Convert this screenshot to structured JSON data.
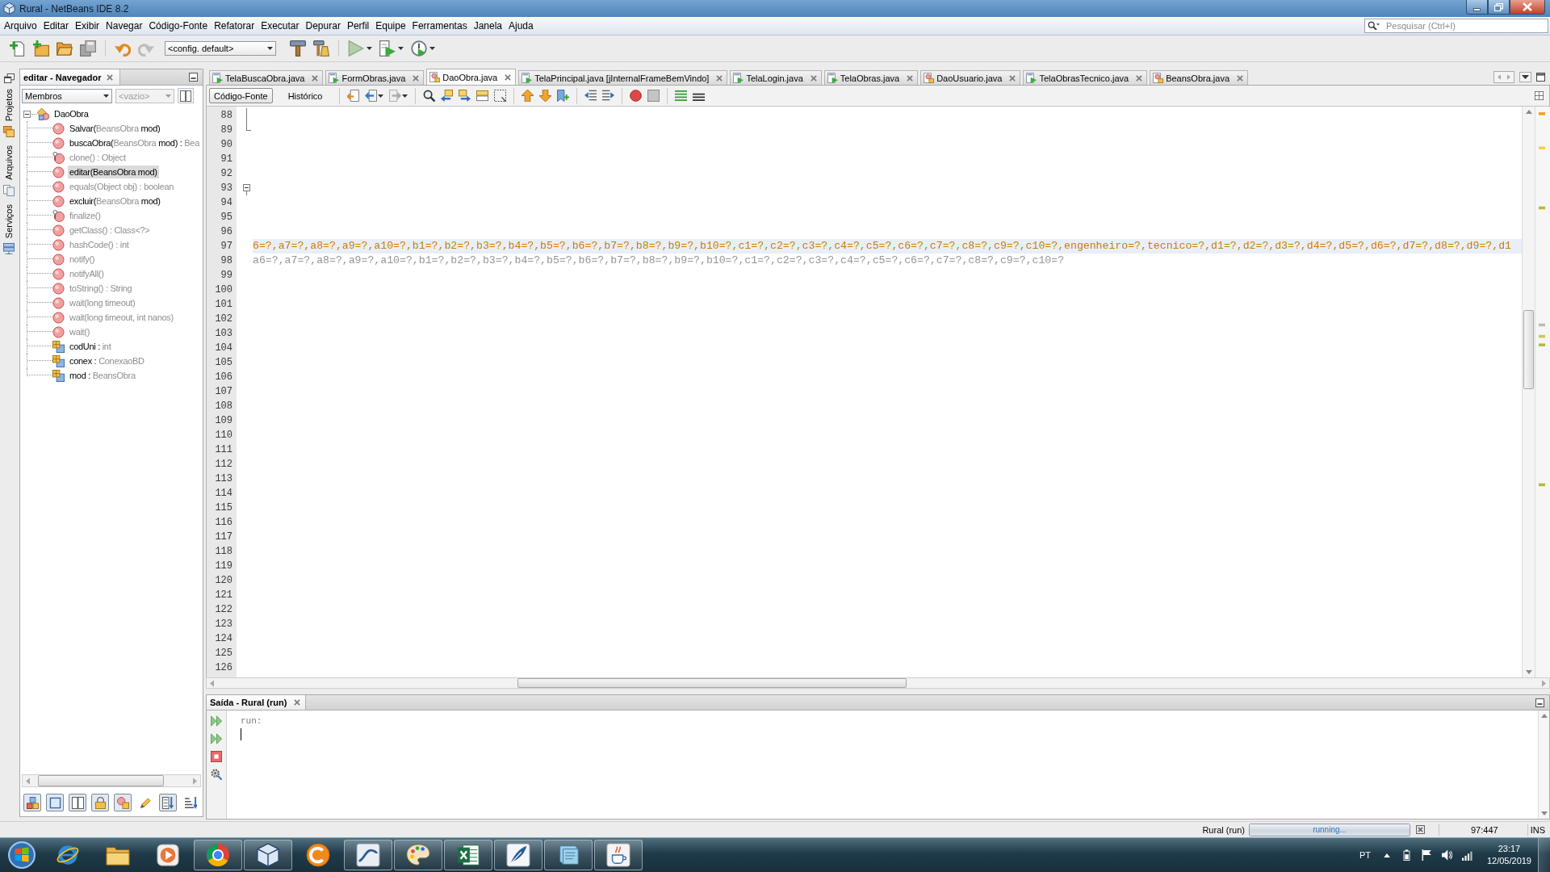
{
  "window": {
    "title": "Rural - NetBeans IDE 8.2"
  },
  "menu": [
    "Arquivo",
    "Editar",
    "Exibir",
    "Navegar",
    "Código-Fonte",
    "Refatorar",
    "Executar",
    "Depurar",
    "Perfil",
    "Equipe",
    "Ferramentas",
    "Janela",
    "Ajuda"
  ],
  "search": {
    "placeholder": "Pesquisar (Ctrl+I)"
  },
  "toolbar": {
    "config": "<config. default>"
  },
  "side_tabs": [
    "Projetos",
    "Arquivos",
    "Serviços"
  ],
  "navigator": {
    "title": "editar - Navegador",
    "filter": {
      "value": "Membros",
      "disabled": false
    },
    "scope": {
      "value": "<vazio>",
      "disabled": true
    },
    "tree": {
      "kind": "class",
      "label": "DaoObra",
      "expanded": true,
      "selected": false,
      "children": [
        {
          "kind": "method",
          "selected": false,
          "segments": [
            {
              "text": "Salvar(",
              "muted": false
            },
            {
              "text": "BeansObra",
              "muted": true
            },
            {
              "text": " mod)",
              "muted": false
            }
          ]
        },
        {
          "kind": "method",
          "selected": false,
          "segments": [
            {
              "text": "buscaObra(",
              "muted": false
            },
            {
              "text": "BeansObra",
              "muted": true
            },
            {
              "text": " mod) : ",
              "muted": false
            },
            {
              "text": "Bea",
              "muted": true
            }
          ]
        },
        {
          "kind": "protected_method",
          "selected": false,
          "segments": [
            {
              "text": "clone() : Object",
              "muted": true
            }
          ]
        },
        {
          "kind": "method",
          "selected": true,
          "segments": [
            {
              "text": "editar(BeansObra mod)",
              "muted": false
            }
          ]
        },
        {
          "kind": "method",
          "selected": false,
          "segments": [
            {
              "text": "equals(Object obj) : boolean",
              "muted": true
            }
          ]
        },
        {
          "kind": "method",
          "selected": false,
          "segments": [
            {
              "text": "excluir(",
              "muted": false
            },
            {
              "text": "BeansObra",
              "muted": true
            },
            {
              "text": " mod)",
              "muted": false
            }
          ]
        },
        {
          "kind": "protected_method",
          "selected": false,
          "segments": [
            {
              "text": "finalize()",
              "muted": true
            }
          ]
        },
        {
          "kind": "method",
          "selected": false,
          "segments": [
            {
              "text": "getClass() : Class<?>",
              "muted": true
            }
          ]
        },
        {
          "kind": "method",
          "selected": false,
          "segments": [
            {
              "text": "hashCode() : int",
              "muted": true
            }
          ]
        },
        {
          "kind": "method",
          "selected": false,
          "segments": [
            {
              "text": "notify()",
              "muted": true
            }
          ]
        },
        {
          "kind": "method",
          "selected": false,
          "segments": [
            {
              "text": "notifyAll()",
              "muted": true
            }
          ]
        },
        {
          "kind": "method",
          "selected": false,
          "segments": [
            {
              "text": "toString() : String",
              "muted": true
            }
          ]
        },
        {
          "kind": "method",
          "selected": false,
          "segments": [
            {
              "text": "wait(long timeout)",
              "muted": true
            }
          ]
        },
        {
          "kind": "method",
          "selected": false,
          "segments": [
            {
              "text": "wait(long timeout, int nanos)",
              "muted": true
            }
          ]
        },
        {
          "kind": "method",
          "selected": false,
          "segments": [
            {
              "text": "wait()",
              "muted": true
            }
          ]
        },
        {
          "kind": "field",
          "selected": false,
          "segments": [
            {
              "text": "codUni : ",
              "muted": false
            },
            {
              "text": "int",
              "muted": true
            }
          ]
        },
        {
          "kind": "field",
          "selected": false,
          "segments": [
            {
              "text": "conex : ",
              "muted": false
            },
            {
              "text": "ConexaoBD",
              "muted": true
            }
          ]
        },
        {
          "kind": "field",
          "selected": false,
          "segments": [
            {
              "text": "mod : ",
              "muted": false
            },
            {
              "text": "BeansObra",
              "muted": true
            }
          ]
        }
      ]
    },
    "filter_buttons": [
      {
        "on": true
      },
      {
        "on": true
      },
      {
        "on": true
      },
      {
        "on": true
      },
      {
        "on": true
      },
      {
        "on": false
      },
      {
        "on": true
      },
      {
        "on": false
      }
    ]
  },
  "editor": {
    "tabs": [
      {
        "label": "TelaBuscaObra.java",
        "kind": "form",
        "selected": false
      },
      {
        "label": "FormObras.java",
        "kind": "form",
        "selected": false
      },
      {
        "label": "DaoObra.java",
        "kind": "class",
        "selected": true
      },
      {
        "label": "TelaPrincipal.java [jInternalFrameBemVindo]",
        "kind": "form",
        "selected": false
      },
      {
        "label": "TelaLogin.java",
        "kind": "form",
        "selected": false
      },
      {
        "label": "TelaObras.java",
        "kind": "form",
        "selected": false
      },
      {
        "label": "DaoUsuario.java",
        "kind": "class",
        "selected": false
      },
      {
        "label": "TelaObrasTecnico.java",
        "kind": "form",
        "selected": false
      },
      {
        "label": "BeansObra.java",
        "kind": "class",
        "selected": false
      }
    ],
    "views": [
      {
        "label": "Código-Fonte",
        "selected": true
      },
      {
        "label": "Histórico",
        "selected": false
      }
    ],
    "lines": [
      {
        "number": "88",
        "highlighted": false,
        "fold": {
          "kind": "guide"
        }
      },
      {
        "number": "89",
        "highlighted": false,
        "fold": {
          "kind": "end"
        }
      },
      {
        "number": "90",
        "highlighted": false
      },
      {
        "number": "91",
        "highlighted": false
      },
      {
        "number": "92",
        "highlighted": false
      },
      {
        "number": "93",
        "highlighted": false,
        "fold": {
          "kind": "start",
          "expanded": true
        }
      },
      {
        "number": "94",
        "highlighted": false
      },
      {
        "number": "95",
        "highlighted": false
      },
      {
        "number": "96",
        "highlighted": false
      },
      {
        "number": "97",
        "highlighted": true,
        "kind": "string",
        "text": "6=?,a7=?,a8=?,a9=?,a10=?,b1=?,b2=?,b3=?,b4=?,b5=?,b6=?,b7=?,b8=?,b9=?,b10=?,c1=?,c2=?,c3=?,c4=?,c5=?,c6=?,c7=?,c8=?,c9=?,c10=?,engenheiro=?,tecnico=?,d1=?,d2=?,d3=?,d4=?,d5=?,d6=?,d7=?,d8=?,d9=?,d1"
      },
      {
        "number": "98",
        "highlighted": false,
        "kind": "comment",
        "text": "a6=?,a7=?,a8=?,a9=?,a10=?,b1=?,b2=?,b3=?,b4=?,b5=?,b6=?,b7=?,b8=?,b9=?,b10=?,c1=?,c2=?,c3=?,c4=?,c5=?,c6=?,c7=?,c8=?,c9=?,c10=?"
      },
      {
        "number": "99",
        "highlighted": false
      },
      {
        "number": "100",
        "highlighted": false
      },
      {
        "number": "101",
        "highlighted": false
      },
      {
        "number": "102",
        "highlighted": false
      },
      {
        "number": "103",
        "highlighted": false
      },
      {
        "number": "104",
        "highlighted": false
      },
      {
        "number": "105",
        "highlighted": false
      },
      {
        "number": "106",
        "highlighted": false
      },
      {
        "number": "107",
        "highlighted": false
      },
      {
        "number": "108",
        "highlighted": false
      },
      {
        "number": "109",
        "highlighted": false
      },
      {
        "number": "110",
        "highlighted": false
      },
      {
        "number": "111",
        "highlighted": false
      },
      {
        "number": "112",
        "highlighted": false
      },
      {
        "number": "113",
        "highlighted": false
      },
      {
        "number": "114",
        "highlighted": false
      },
      {
        "number": "115",
        "highlighted": false
      },
      {
        "number": "116",
        "highlighted": false
      },
      {
        "number": "117",
        "highlighted": false
      },
      {
        "number": "118",
        "highlighted": false
      },
      {
        "number": "119",
        "highlighted": false
      },
      {
        "number": "120",
        "highlighted": false
      },
      {
        "number": "121",
        "highlighted": false
      },
      {
        "number": "122",
        "highlighted": false
      },
      {
        "number": "123",
        "highlighted": false
      },
      {
        "number": "124",
        "highlighted": false
      },
      {
        "number": "125",
        "highlighted": false
      },
      {
        "number": "126",
        "highlighted": false
      }
    ]
  },
  "output": {
    "title": "Saída - Rural (run)",
    "lines": [
      "run:"
    ]
  },
  "status_bar": {
    "task": "Rural (run)",
    "progress": {
      "text": "running...",
      "level": 1
    },
    "position": "97:447",
    "mode": "INS"
  },
  "taskbar": {
    "apps": [
      {
        "kind": "globe",
        "running": false
      },
      {
        "kind": "folder",
        "running": false
      },
      {
        "kind": "player",
        "running": false
      },
      {
        "kind": "wheel",
        "running": true
      },
      {
        "kind": "cube",
        "running": true
      },
      {
        "kind": "disc",
        "running": false
      },
      {
        "kind": "wave",
        "running": true
      },
      {
        "kind": "palette",
        "running": true
      },
      {
        "kind": "sheet",
        "running": true
      },
      {
        "kind": "feather",
        "running": true
      },
      {
        "kind": "notebook",
        "running": true
      },
      {
        "kind": "cup",
        "running": true
      }
    ],
    "language": "PT",
    "time": "23:17",
    "date": "12/05/2019"
  }
}
